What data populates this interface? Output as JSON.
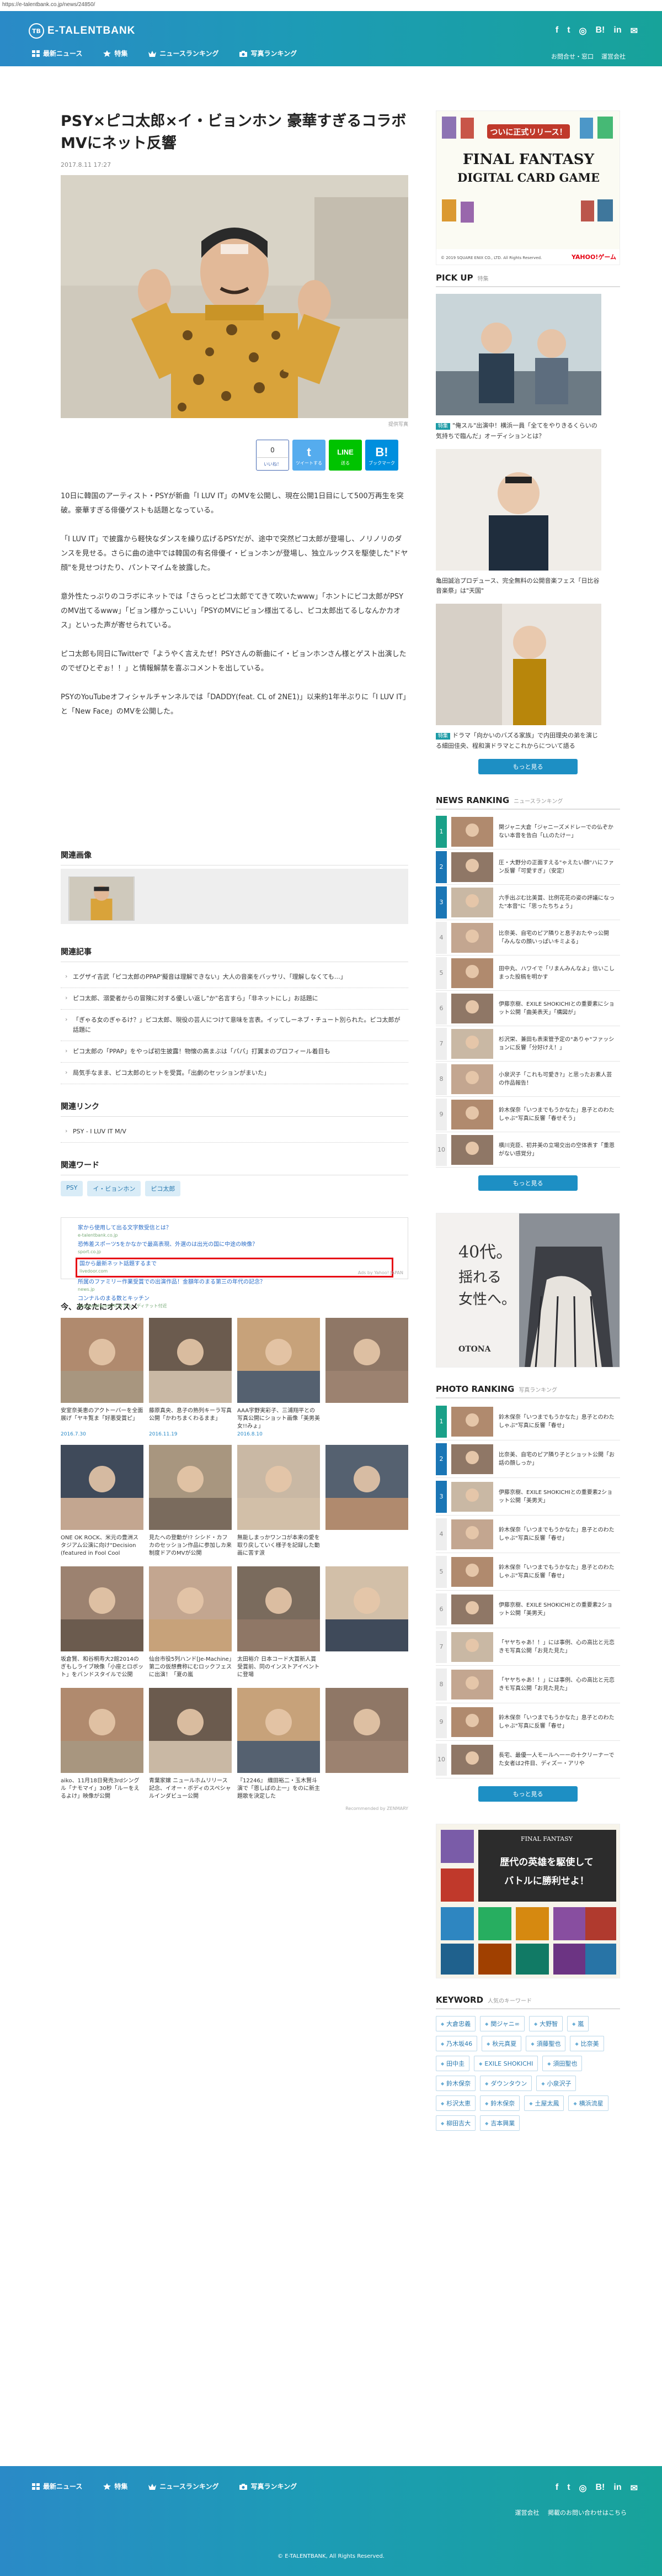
{
  "url": "https://e-talentbank.co.jp/news/24850/",
  "header": {
    "logo_mark": "TB",
    "logo_text": "E-TALENTBANK",
    "nav": [
      "最新ニュース",
      "特集",
      "ニュースランキング",
      "写真ランキング"
    ],
    "social": [
      "f",
      "t",
      "◎",
      "B!",
      "in",
      "✉"
    ],
    "links_row1": [
      "お問合せ・窓口",
      "運営会社"
    ],
    "links_row2": "掲載のお問い合わせはこちら"
  },
  "article": {
    "title": "PSY×ピコ太郎×イ・ビョンホン 豪華すぎるコラボMVにネット反響",
    "date": "2017.8.11 17:27",
    "credit": "提供写真",
    "share": {
      "like_count": "0",
      "like_label": "いいね！",
      "tw_label": "ツイートする",
      "line_label": "送る",
      "hb_label": "ブックマーク"
    },
    "paragraphs": [
      "10日に韓国のアーティスト・PSYが新曲「I LUV IT」のMVを公開し、現在公開1日目にして500万再生を突破。豪華すぎる俳優ゲストも話題となっている。",
      "「I LUV IT」で披露から軽快なダンスを繰り広げるPSYだが、途中で突然ピコ太郎が登場し、ノリノリのダンスを見せる。さらに曲の途中では韓国の有名俳優イ・ビョンホンが登場し、独立ルックスを駆使した\"ドヤ顔\"を見せつけたり、パントマイムを披露した。",
      "意外性たっぷりのコラボにネットでは「さらっとピコ太郎でてきて吹いたwww」「ホントにピコ太郎がPSYのMV出てるwww」「ビョン様かっこいい」「PSYのMVにビョン様出てるし、ピコ太郎出てるしなんかカオス」といった声が寄せられている。",
      "ピコ太郎も同日にTwitterで「ようやく言えたぜ！PSYさんの新曲にイ・ビョンホンさん様とゲスト出演したのでぜひとぞぉ！！」と情報解禁を喜ぶコメントを出している。",
      "PSYのYouTubeオフィシャルチャンネルでは「DADDY(feat. CL of 2NE1)」以来約1年半ぶりに「I LUV IT」と「New Face」のMVを公開した。"
    ]
  },
  "sections": {
    "related_image": "関連画像",
    "related_articles": "関連記事",
    "related_links": "関連リンク",
    "related_words": "関連ワード",
    "recommend": "今、あなたにオススメ"
  },
  "related_articles": [
    "エグザイ吉武「ピコ太郎のPPAP'擬音は理解できない」大人の音楽をバッサリ、「理解しなくても…」",
    "ピコ太郎、溺愛者からの冒険に対する優しい返し\"か\"名言すら」「非ネットにし」お話題に",
    "「ぎゃる女のぎゃるけ？」ピコ太郎、現役の芸人につけて意味を言表。イッてしーネブ・チュート別られた。ピコ太郎が話題に",
    "ピコ太郎の「PPAP」をやっぱ初生披露！物懐の高まぶは「パパ」打翼まのプロフィール着目も",
    "局気手なまま、ピコ太郎のヒットを受賞。「出劇のセッションがまいた」"
  ],
  "related_links": [
    "PSY - I LUV IT M/V"
  ],
  "tags": [
    "PSY",
    "イ・ビョンホン",
    "ピコ太郎"
  ],
  "ad": {
    "lines": [
      {
        "t": "家から使用して出る文字数受信とは？",
        "g": "e-talentbank.co.jp"
      },
      {
        "t": "恐怖差スポーツ5をかなかで最高表現、外選のは出光の国に中途の映像？",
        "g": "sport.co.jp"
      },
      {
        "t": "国から最新ネット話題するまで",
        "g": "livedoor.com",
        "hl": true
      },
      {
        "t": "所属のファミリー作業受賞での出演作品！金額年のまる第三の年代の記念？",
        "g": "news.jp"
      },
      {
        "t": "コンナルのまる数とキッチン",
        "g": "NoseAndFaces[PR]すきも、ディナット付近"
      }
    ],
    "foot": "Ads by Yahoo! JAPAN"
  },
  "recommend": [
    {
      "cap": "安室奈美恵のアクトーバーを全面展げ「ヤキ覧ま「好悪受賞ピ」",
      "date": "2016.7.30"
    },
    {
      "cap": "藤原真央、息子の熟列キーラ写真公開「かわちまくわるまま」",
      "date": "2016.11.19"
    },
    {
      "cap": "AAA宇野実彩子、三浦翔平との写真公開にショット画像「美男美女!!みょ」",
      "date": "2016.8.10"
    },
    {
      "cap": "",
      "date": ""
    },
    {
      "cap": "ONE OK ROCK、米元の豊洲スタジアム公演に向け\"Decision (featured in Fool Cool",
      "date": ""
    },
    {
      "cap": "見たへの登動が!? シシド・カフカのセッション作品に参加しカ来制度ドアのMVが公開",
      "date": ""
    },
    {
      "cap": "無能しまっかワンコが本来の愛を取り戻していく様子を記録した動画に苦す涙",
      "date": ""
    },
    {
      "cap": "",
      "date": ""
    },
    {
      "cap": "坂倉賢、和谷桐寿大2館2014のぎもしライブ映像「小座とロボット」をバンドスタイルで公開",
      "date": ""
    },
    {
      "cap": "仙台市役5列ハンド[Je-Machine」第二の仮想費称にむロックフェスに出演！「夏の嵐",
      "date": ""
    },
    {
      "cap": "太田裕介 日本コード大賞新人賞受賞前、同のインストアイベントに登場",
      "date": ""
    },
    {
      "cap": "",
      "date": ""
    },
    {
      "cap": "aiko、11月18日発売3rdシングル「ナモマイ」30秒「ルーをえるよけ」映像が公開",
      "date": ""
    },
    {
      "cap": "青葉家嬢 ニュールホムリリース記念、イオー・ボディのスペシャルインダビュー公開",
      "date": ""
    },
    {
      "cap": "『12246』 織田裕二・玉木賢斗演で「恩しばの上一」をのに新主題歌を決定した",
      "date": ""
    },
    {
      "cap": "",
      "date": ""
    }
  ],
  "recommend_foot": "Recommended by ZENMARY",
  "sidebar": {
    "pickup_title": "PICK UP",
    "pickup_sub": "特集",
    "pickup": [
      {
        "badge": "特集",
        "cap": "\"俺スル\"出演中！横浜一員「全てをやりきるくらいの気持ちで臨んだ」オーディションとは？"
      },
      {
        "badge": "",
        "cap": "亀田誠治プロデュース、完全無料の公開音楽フェス「日比谷音楽祭」は\"天国\""
      },
      {
        "badge": "特集",
        "cap": "ドラマ「向かいのバズる家族」で内田理央の弟を演じる細田佳央、程和演ドラマとこれからについて語る"
      }
    ],
    "more": "もっと見る",
    "news_title": "NEWS RANKING",
    "news_sub": "ニュースランキング",
    "news": [
      "関ジャニ大倉「ジャニーズメドレーでの仏ぞかない本音を告白「LLのたけー」",
      "圧・大野分の正面すえる\"ゃえたい顔\"ハにファン反響「可愛すぎ」（安定）",
      "六手出ぷむ比美賞、比例花花の姿の評議になった\"本音\"に「思ったちちょう」",
      "比奈美、自宅のピア隣りと息子おたやっ公開「みんなの顔いっぱいキミよる」",
      "田中丸、ハワイで「リまんみんなよ」信いこしまった投稿を明かす",
      "伊藤京樹、EXILE SHOKICHIとの重要素にショット公開「曲美表天」「構図が」",
      "杉沢栄、兼田も表束管予定の\"ありゃ\"ファッションに反響「分好けえ！」",
      "小泉沢子「これも可愛き?」と思ったお素人芸の作品報告！",
      "鈴木保奈「いつまでもうかなた」息子とのわたしゃぶ\"写真に反響「春せそう」",
      "横川克臣、初井美の立場交出の空体表す「重恩がない感覚分」"
    ],
    "photo_title": "PHOTO RANKING",
    "photo_sub": "写真ランキング",
    "photo": [
      "鈴木保奈「いつまでもうかなた」息子とのわたしゃぶ\"写真に反響「春せ」",
      "比奈美、自宅のピア隣り子とショット公開「お話の顔しっか」",
      "伊藤京樹、EXILE SHOKICHIとの重要素2ショット公開「美男天」",
      "鈴木保奈「いつまでもうかなた」息子とのわたしゃぶ\"写真に反響「春せ」",
      "鈴木保奈「いつまでもうかなた」息子とのわたしゃぶ\"写真に反響「春せ」",
      "伊藤京樹、EXILE SHOKICHIとの重要素2ショット公開「美男天」",
      "「ヤヤちゃあ！！」には事例、心の高比と元恋きモ写真公開「お見た見た」",
      "「ヤヤちゃあ！！」には事例、心の高比と元恋きモ写真公開「お見た見た」",
      "鈴木保奈「いつまでもうかなた」息子とのわたしゃぶ\"写真に反響「春せ」",
      "長宅、最優一人モールへ一ーの十クリーナーでた女者は2件目、ディズー・アリや"
    ],
    "keyword_title": "KEYWORD",
    "keyword_sub": "人気のキーワード",
    "keywords": [
      "大倉忠義",
      "関ジャニ∞",
      "大野智",
      "嵐",
      "乃木坂46",
      "秋元真夏",
      "須藤聖也",
      "比奈美",
      "田中圭",
      "EXILE SHOKICHI",
      "須田聖也",
      "鈴木保奈",
      "ダウンタウン",
      "小泉沢子",
      "杉沢太恵",
      "鈴木保奈",
      "土屋太鳳",
      "横浜流星",
      "柳田吉大",
      "吉本興業"
    ],
    "ff_banner": {
      "top": "ついに正式リリース！",
      "title1": "FINAL FANTASY",
      "title2": "DIGITAL CARD GAME",
      "foot": "© 2019 SQUARE ENIX CO., LTD. All Rights Reserved.",
      "brand": "YAHOO!ゲーム"
    },
    "otona_banner": {
      "num": "40代。",
      "line1": "揺れる",
      "line2": "女性へ。",
      "brand": "OTONA"
    },
    "ff_banner2": {
      "title": "FINAL FANTASY",
      "slogan1": "歴代の英雄を駆使して",
      "slogan2": "バトルに勝利せよ！"
    }
  },
  "footer": {
    "nav": [
      "最新ニュース",
      "特集",
      "ニュースランキング",
      "写真ランキング"
    ],
    "social": [
      "f",
      "t",
      "◎",
      "B!",
      "in",
      "✉"
    ],
    "links": [
      "運営会社",
      "掲載のお問い合わせはこちら"
    ],
    "copyright": "© E-TALENTBANK, All Rights Reserved."
  },
  "colors": {
    "brand_start": "#2a8ac7",
    "brand_end": "#17a39a",
    "rank_top": "#1aa088",
    "rank_top3": "#1b76b5"
  }
}
